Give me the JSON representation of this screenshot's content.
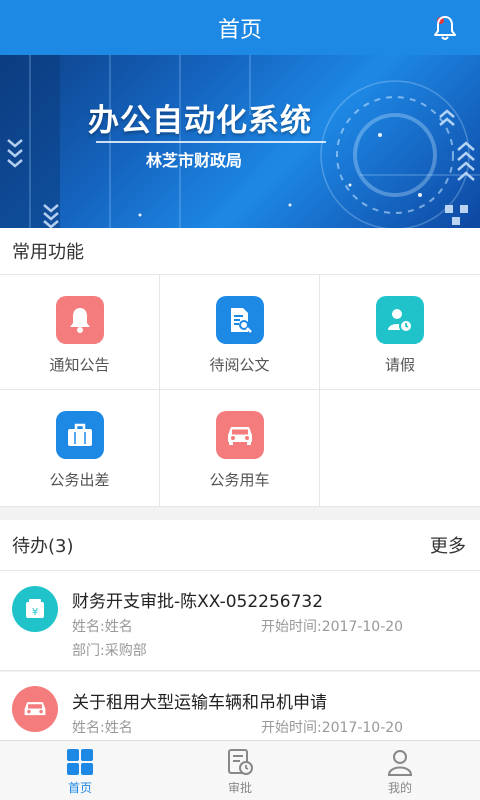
{
  "header": {
    "title": "首页"
  },
  "banner": {
    "title": "办公自动化系统",
    "subtitle": "林芝市财政局"
  },
  "functions": {
    "section_label": "常用功能",
    "items": [
      {
        "label": "通知公告",
        "icon": "bell-icon",
        "color": "#f47c7c"
      },
      {
        "label": "待阅公文",
        "icon": "document-search-icon",
        "color": "#1e88e5"
      },
      {
        "label": "请假",
        "icon": "person-clock-icon",
        "color": "#1fc3c9"
      },
      {
        "label": "公务出差",
        "icon": "briefcase-icon",
        "color": "#1e88e5"
      },
      {
        "label": "公务用车",
        "icon": "car-icon",
        "color": "#f47c7c"
      }
    ]
  },
  "todo": {
    "section_label": "待办(3)",
    "more_label": "更多",
    "items": [
      {
        "title": "财务开支审批-陈XX-052256732",
        "name": "姓名:姓名",
        "start": "开始时间:2017-10-20",
        "dept": "部门:采购部",
        "icon": "money-icon",
        "color": "#1fc3c9"
      },
      {
        "title": "关于租用大型运输车辆和吊机申请",
        "name": "姓名:姓名",
        "start": "开始时间:2017-10-20",
        "icon": "car-icon",
        "color": "#f47c7c"
      }
    ]
  },
  "tabbar": {
    "tabs": [
      {
        "label": "首页",
        "icon": "grid-icon",
        "active": true
      },
      {
        "label": "审批",
        "icon": "approval-icon",
        "active": false
      },
      {
        "label": "我的",
        "icon": "user-icon",
        "active": false
      }
    ],
    "active_color": "#1e88e5"
  }
}
